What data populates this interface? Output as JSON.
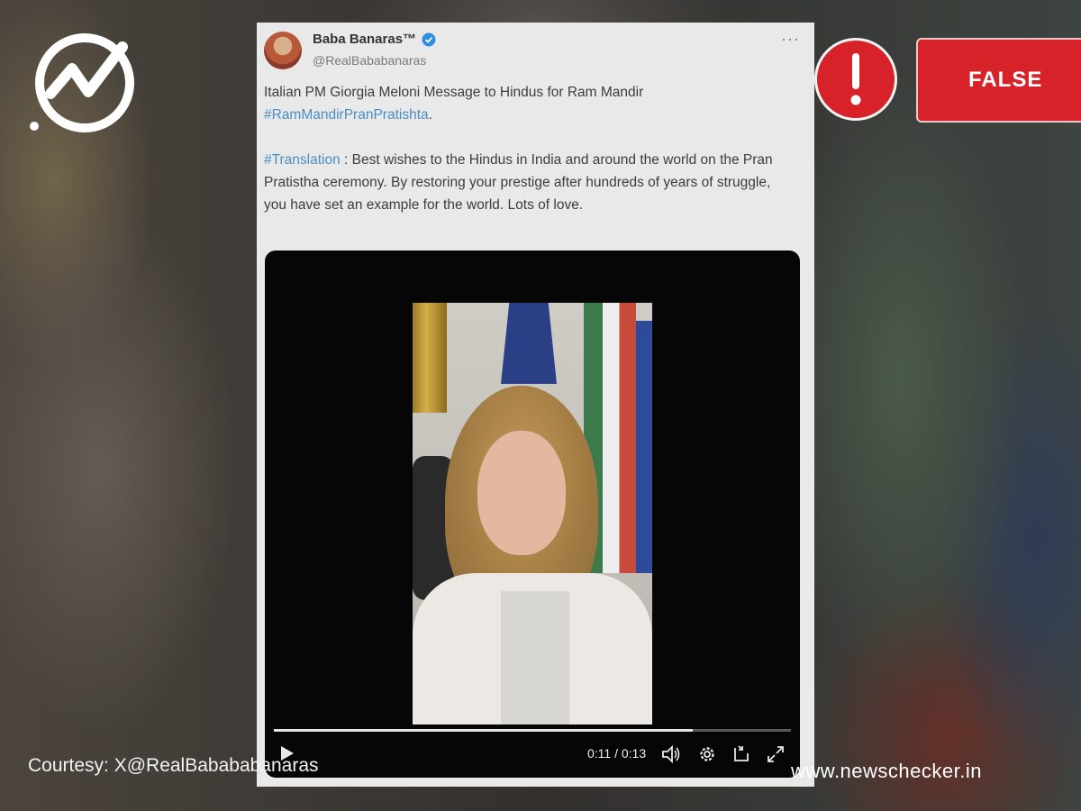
{
  "background": {
    "dim": true
  },
  "brand": {
    "logo_icon": "newschecker-logo-icon",
    "website": "www.newschecker.in"
  },
  "courtesy": "Courtesy: X@RealBabababanaras",
  "verdict": {
    "label": "FALSE",
    "color": "#d8222a",
    "icon": "exclamation-icon"
  },
  "tweet": {
    "display_name": "Baba Banaras™",
    "verified_icon": "verified-badge-icon",
    "handle": "@RealBababanaras",
    "more_label": "···",
    "text_line1": "Italian PM Giorgia Meloni Message to Hindus for Ram Mandir",
    "hashtag1": "#RamMandirPranPratishta",
    "hashtag1_suffix": ".",
    "hashtag2": "#Translation",
    "translation": " : Best wishes to the Hindus in India and around the world on the Pran Pratistha ceremony. By restoring your prestige after hundreds of years of struggle, you have set an example for the world. Lots of love."
  },
  "video": {
    "current_time": "0:11",
    "duration": "0:13",
    "time_display": "0:11 / 0:13",
    "progress_fraction": 0.81,
    "controls": [
      "play-icon",
      "volume-icon",
      "settings-icon",
      "pip-icon",
      "fullscreen-icon"
    ]
  }
}
